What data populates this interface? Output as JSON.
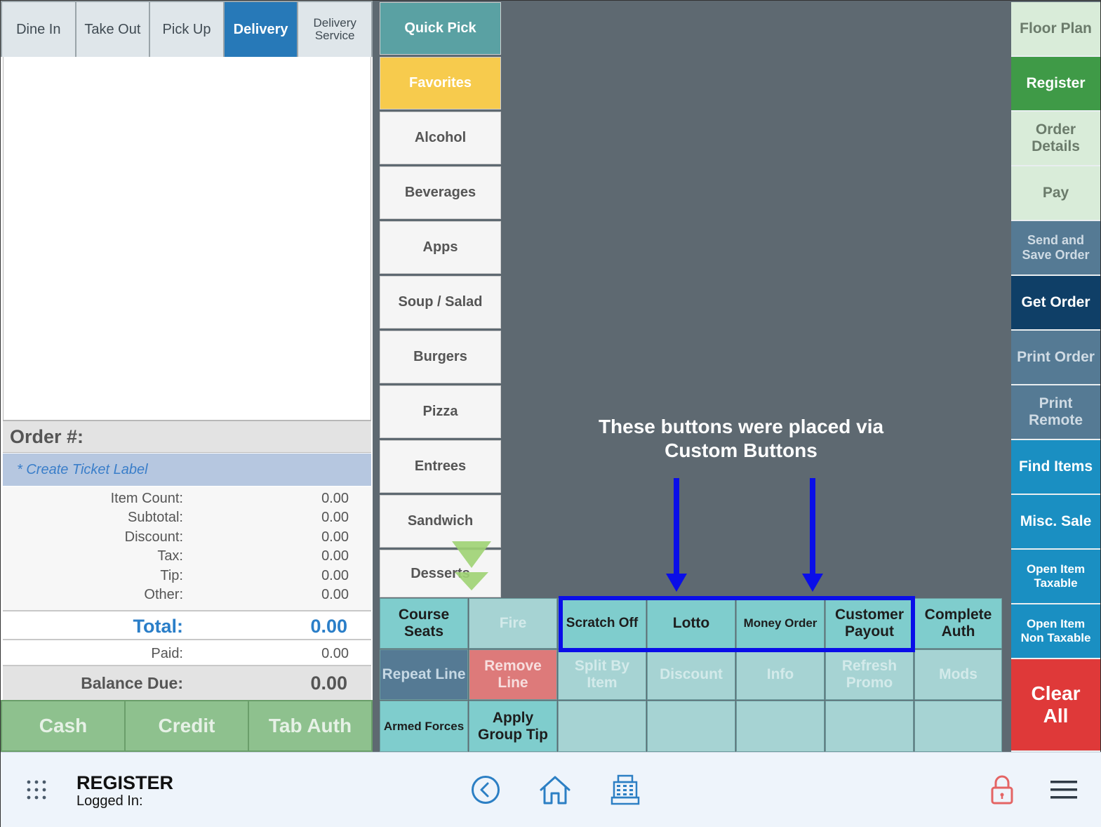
{
  "order_types": [
    {
      "label": "Dine In",
      "active": false
    },
    {
      "label": "Take Out",
      "active": false
    },
    {
      "label": "Pick Up",
      "active": false
    },
    {
      "label": "Delivery",
      "active": true
    },
    {
      "label": "Delivery Service",
      "active": false
    }
  ],
  "order": {
    "header": "Order #:",
    "ticket_label": "* Create Ticket Label",
    "rows": [
      {
        "label": "Item Count:",
        "value": "0.00"
      },
      {
        "label": "Subtotal:",
        "value": "0.00"
      },
      {
        "label": "Discount:",
        "value": "0.00"
      },
      {
        "label": "Tax:",
        "value": "0.00"
      },
      {
        "label": "Tip:",
        "value": "0.00"
      },
      {
        "label": "Other:",
        "value": "0.00"
      }
    ],
    "total_label": "Total:",
    "total_value": "0.00",
    "paid_label": "Paid:",
    "paid_value": "0.00",
    "balance_label": "Balance Due:",
    "balance_value": "0.00"
  },
  "payment_buttons": [
    "Cash",
    "Credit",
    "Tab Auth"
  ],
  "categories": [
    "Quick Pick",
    "Favorites",
    "Alcohol",
    "Beverages",
    "Apps",
    "Soup / Salad",
    "Burgers",
    "Pizza",
    "Entrees",
    "Sandwich",
    "Desserts"
  ],
  "right_buttons": [
    {
      "label": "Floor Plan",
      "style": "pale"
    },
    {
      "label": "Register",
      "style": "green"
    },
    {
      "label": "Order Details",
      "style": "pale"
    },
    {
      "label": "Pay",
      "style": "pale"
    },
    {
      "label": "Send and Save Order",
      "style": "slate"
    },
    {
      "label": "Get Order",
      "style": "navy"
    },
    {
      "label": "Print Order",
      "style": "steel"
    },
    {
      "label": "Print Remote",
      "style": "steel"
    },
    {
      "label": "Find Items",
      "style": "blue"
    },
    {
      "label": "Misc. Sale",
      "style": "blue"
    },
    {
      "label": "Open Item Taxable",
      "style": "blue"
    },
    {
      "label": "Open Item Non Taxable",
      "style": "blue"
    },
    {
      "label": "Clear All",
      "style": "red"
    }
  ],
  "action_buttons": {
    "row1": [
      "Course Seats",
      "Fire",
      "Scratch Off",
      "Lotto",
      "Money Order",
      "Customer Payout",
      "Complete Auth"
    ],
    "row2": [
      "Repeat Line",
      "Remove Line",
      "Split By Item",
      "Discount",
      "Info",
      "Refresh Promo",
      "Mods"
    ],
    "row3": [
      "Armed Forces",
      "Apply Group Tip",
      "",
      "",
      "",
      "",
      ""
    ]
  },
  "annotation": {
    "text": "These buttons were placed via Custom Buttons"
  },
  "footer": {
    "title": "REGISTER",
    "logged_in": "Logged In:"
  },
  "colors": {
    "background": "#5e6971",
    "delivery_active": "#2779b8",
    "quick_pick": "#5aa1a3",
    "favorites": "#f7cb4d",
    "register_green": "#3f9a47",
    "get_order_navy": "#0f3f67",
    "find_items_blue": "#1a8fc2",
    "clear_all_red": "#df3939",
    "highlight_blue": "#0a0ee8",
    "teal_button": "#7fcdcd"
  },
  "icons": [
    "apps-grid-icon",
    "back-circle-icon",
    "home-icon",
    "cash-register-icon",
    "lock-icon",
    "hamburger-menu-icon",
    "arrow-down-icon"
  ]
}
